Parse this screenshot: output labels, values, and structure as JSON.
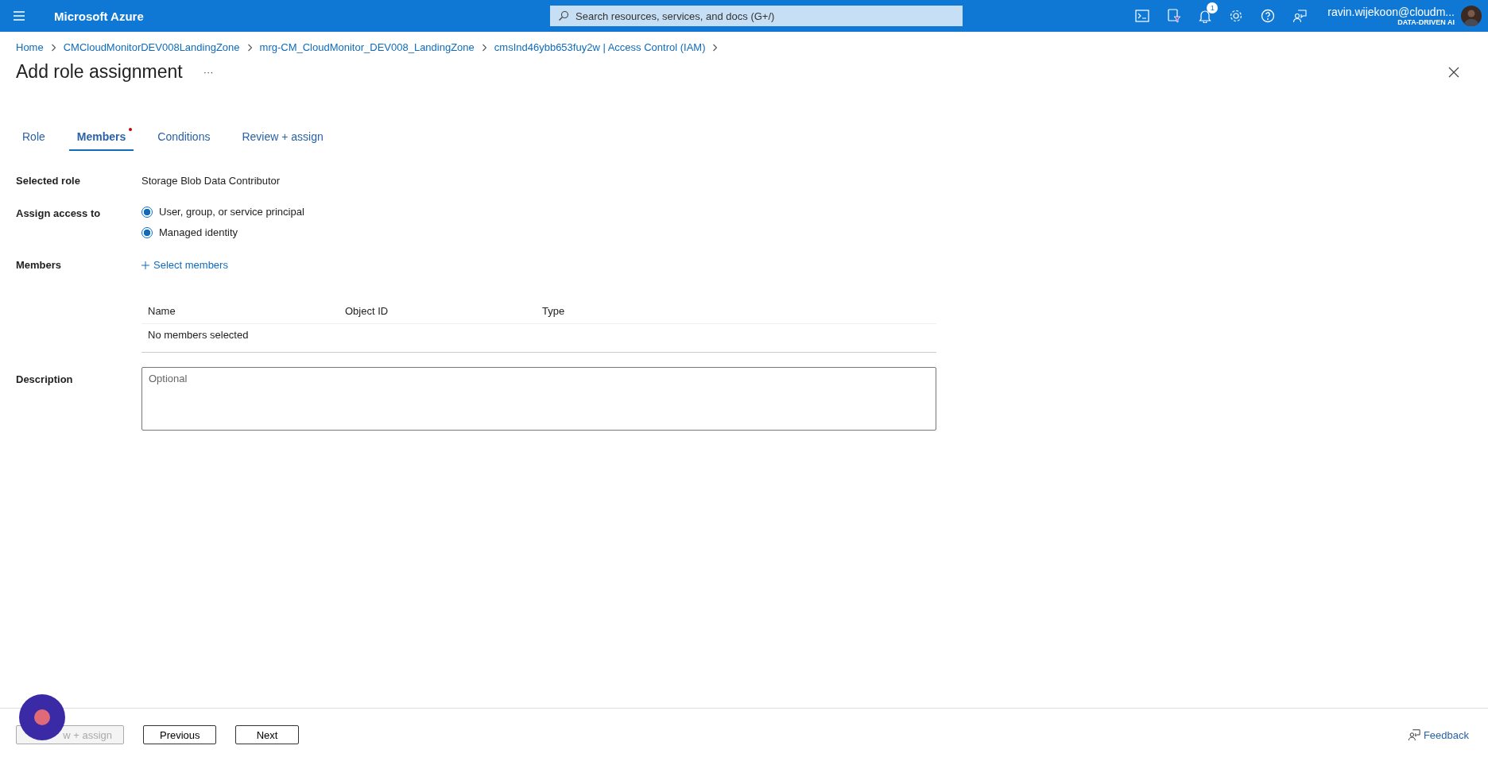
{
  "topbar": {
    "brand": "Microsoft Azure",
    "search": {
      "placeholder": "Search resources, services, and docs (G+/)"
    },
    "notification_count": "1",
    "user": {
      "name": "ravin.wijekoon@cloudm...",
      "org": "DATA-DRIVEN AI"
    }
  },
  "breadcrumb": [
    "Home",
    "CMCloudMonitorDEV008LandingZone",
    "mrg-CM_CloudMonitor_DEV008_LandingZone",
    "cmsInd46ybb653fuy2w | Access Control (IAM)"
  ],
  "title": "Add role assignment",
  "more": "···",
  "tabs": [
    {
      "label": "Role",
      "selected": false,
      "required": false
    },
    {
      "label": "Members",
      "selected": true,
      "required": true
    },
    {
      "label": "Conditions",
      "selected": false,
      "required": false
    },
    {
      "label": "Review + assign",
      "selected": false,
      "required": false
    }
  ],
  "selected_role": {
    "label": "Selected role",
    "value": "Storage Blob Data Contributor"
  },
  "assign_access": {
    "label": "Assign access to",
    "options": [
      {
        "label": "User, group, or service principal",
        "selected": true
      },
      {
        "label": "Managed identity",
        "selected": true
      }
    ]
  },
  "members": {
    "label": "Members",
    "action": "Select members",
    "table": {
      "columns": [
        "Name",
        "Object ID",
        "Type"
      ],
      "empty": "No members selected"
    }
  },
  "description": {
    "label": "Description",
    "placeholder": "Optional"
  },
  "footer": {
    "buttons": [
      {
        "label": "w + assign",
        "disabled": true
      },
      {
        "label": "Previous",
        "disabled": false
      },
      {
        "label": "Next",
        "disabled": false
      }
    ],
    "feedback": "Feedback"
  }
}
